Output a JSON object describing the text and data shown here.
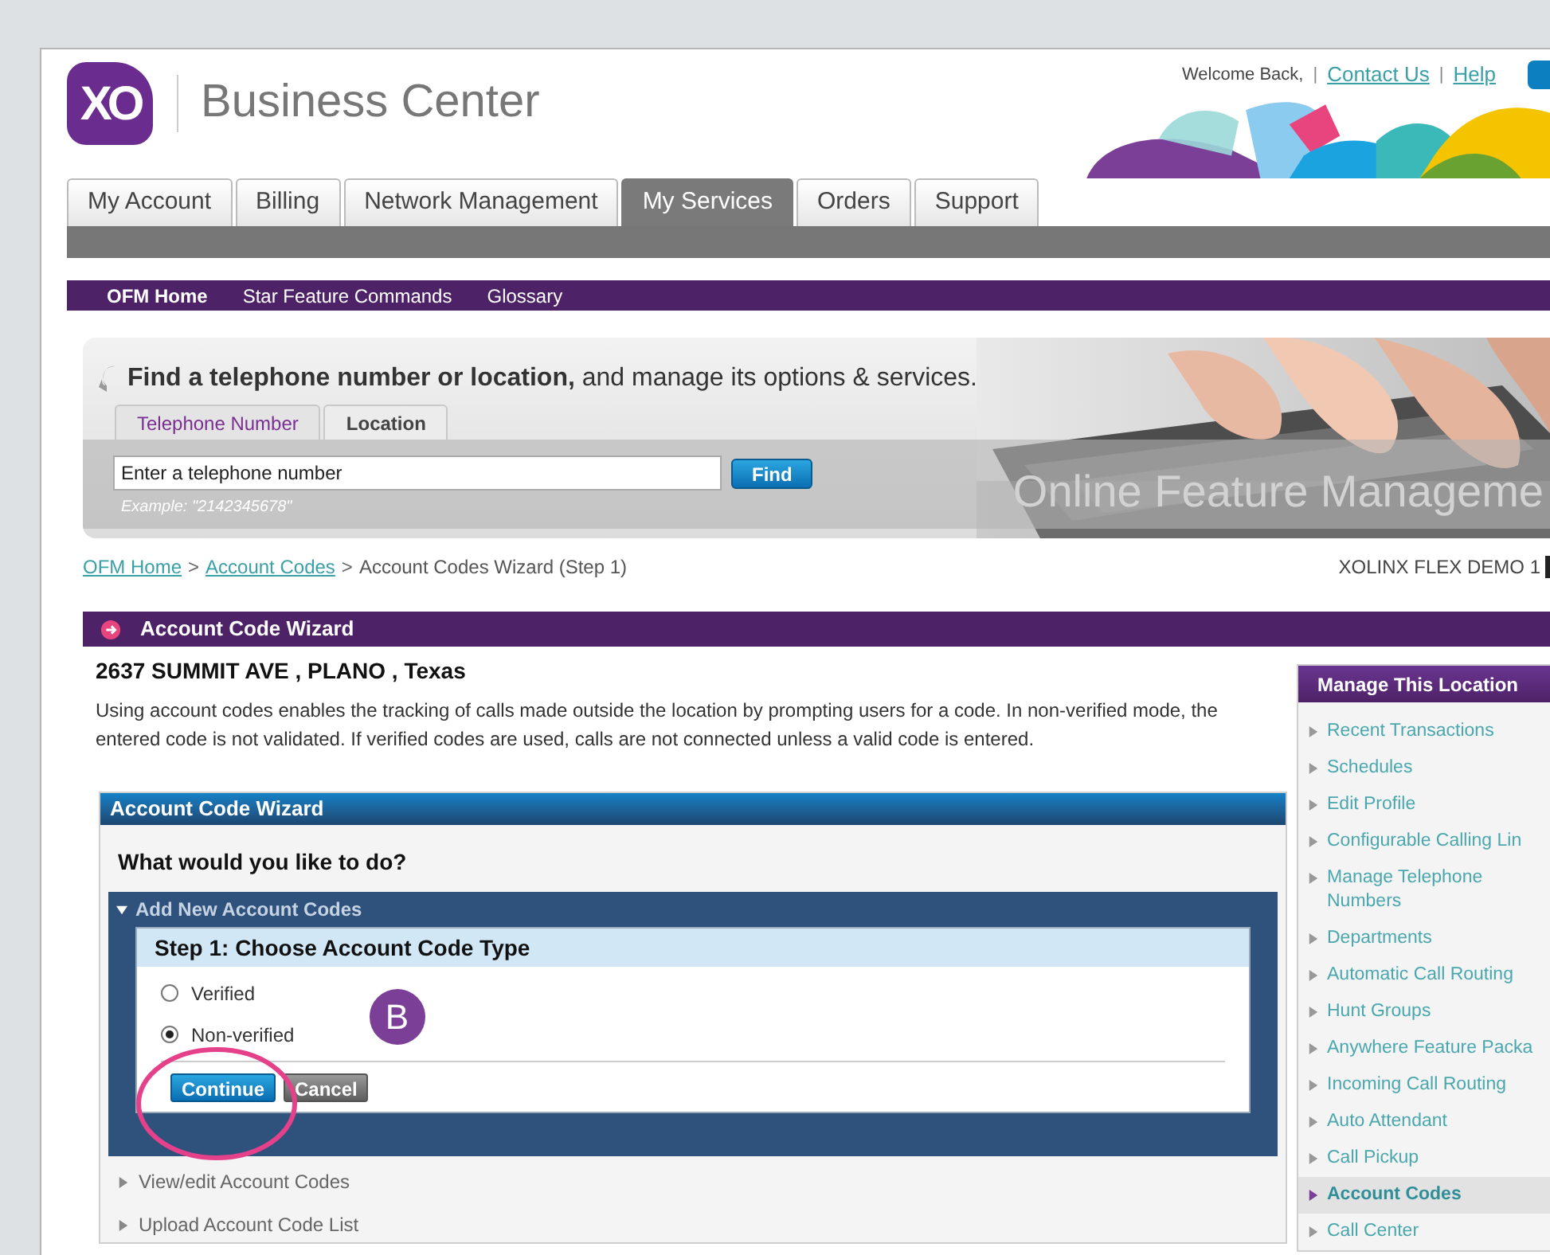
{
  "header": {
    "logo": "XO",
    "brand": "Business Center",
    "welcome": "Welcome Back,",
    "separator": "|",
    "links": [
      "Contact Us",
      "Help"
    ]
  },
  "tabs": [
    {
      "label": "My Account",
      "selected": false
    },
    {
      "label": "Billing",
      "selected": false
    },
    {
      "label": "Network Management",
      "selected": false
    },
    {
      "label": "My Services",
      "selected": true
    },
    {
      "label": "Orders",
      "selected": false
    },
    {
      "label": "Support",
      "selected": false
    }
  ],
  "subnav": [
    {
      "label": "OFM Home",
      "selected": true
    },
    {
      "label": "Star Feature Commands",
      "selected": false
    },
    {
      "label": "Glossary",
      "selected": false
    }
  ],
  "search": {
    "heading": "**Find a telephone number or location,** and manage its options & services.",
    "tabs": [
      {
        "label": "Telephone Number",
        "selected": true
      },
      {
        "label": "Location",
        "selected": false
      }
    ],
    "value": "Enter a telephone number",
    "button": "Find",
    "example": "Example: \"2142345678\"",
    "banner": "Online Feature Manageme"
  },
  "breadcrumb": {
    "separator": ">",
    "items": [
      {
        "label": "OFM Home",
        "kind": "link"
      },
      {
        "label": "Account Codes",
        "kind": "link"
      },
      {
        "label": "Account Codes Wizard (Step 1)",
        "kind": "text"
      }
    ],
    "account": "XOLINX FLEX DEMO 1"
  },
  "panel": {
    "title": "Account Code Wizard",
    "address": "2637 SUMMIT AVE , PLANO , Texas",
    "description": "Using account codes enables the tracking of calls made outside the location by prompting users for a code. In non-verified mode, the entered code is not validated. If verified codes are used, calls are not connected unless a valid code is entered."
  },
  "wizard": {
    "title": "Account Code Wizard",
    "question": "What would you like to do?",
    "sections": [
      {
        "label": "Add New Account Codes",
        "expanded": true
      },
      {
        "label": "View/edit Account Codes",
        "expanded": false
      },
      {
        "label": "Upload Account Code List",
        "expanded": false
      }
    ],
    "step_title": "Step 1: Choose Account Code Type",
    "options": [
      {
        "label": "Verified",
        "selected": false
      },
      {
        "label": "Non-verified",
        "selected": true
      }
    ],
    "annotation": "B",
    "buttons": [
      {
        "label": "Continue",
        "kind": "primary"
      },
      {
        "label": "Cancel",
        "kind": "secondary"
      }
    ]
  },
  "sidebar": {
    "title": "Manage This Location",
    "items": [
      {
        "label": "Recent Transactions",
        "selected": false
      },
      {
        "label": "Schedules",
        "selected": false
      },
      {
        "label": "Edit Profile",
        "selected": false
      },
      {
        "label": "Configurable Calling Lin",
        "selected": false
      },
      {
        "label": "Manage Telephone Numbers",
        "selected": false
      },
      {
        "label": "Departments",
        "selected": false
      },
      {
        "label": "Automatic Call Routing",
        "selected": false
      },
      {
        "label": "Hunt Groups",
        "selected": false
      },
      {
        "label": "Anywhere Feature Packa",
        "selected": false
      },
      {
        "label": "Incoming Call Routing",
        "selected": false
      },
      {
        "label": "Auto Attendant",
        "selected": false
      },
      {
        "label": "Call Pickup",
        "selected": false
      },
      {
        "label": "Account Codes",
        "selected": true
      },
      {
        "label": "Call Center",
        "selected": false
      }
    ]
  }
}
